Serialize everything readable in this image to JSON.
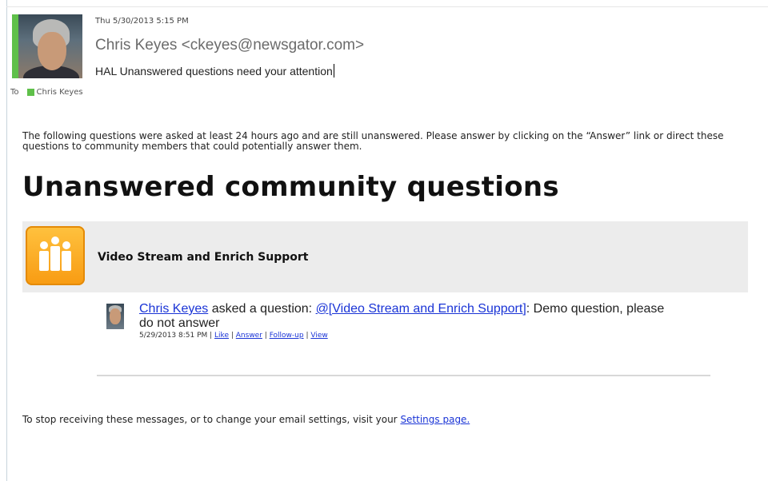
{
  "email": {
    "date": "Thu 5/30/2013 5:15 PM",
    "from": "Chris Keyes <ckeyes@newsgator.com>",
    "subject": "HAL Unanswered questions need your attention",
    "to_label": "To",
    "to_name": "Chris Keyes"
  },
  "body": {
    "intro": "The following questions were asked at least 24 hours ago and are still unanswered. Please answer by clicking on the “Answer” link or direct these questions to community members that could potentially answer them.",
    "heading": "Unanswered community questions",
    "community_name": "Video Stream and Enrich Support",
    "post": {
      "author": "Chris Keyes",
      "asked_text": " asked a question: ",
      "mention": "@[Video Stream and Enrich Support]",
      "question_text": ": Demo question, please do not answer",
      "timestamp": "5/29/2013 8:51 PM",
      "sep": " | ",
      "like": "Like",
      "answer": "Answer",
      "follow_up": "Follow-up",
      "view": "View"
    },
    "footer_text": "To stop receiving these messages, or to change your email settings, visit your ",
    "footer_link": "Settings page."
  },
  "colors": {
    "presence": "#5fc04a",
    "link": "#1a34d6",
    "community_bar": "#ececec",
    "community_icon": "#f89b12"
  },
  "icons": {
    "community": "community-people-icon",
    "presence": "presence-status-icon"
  }
}
